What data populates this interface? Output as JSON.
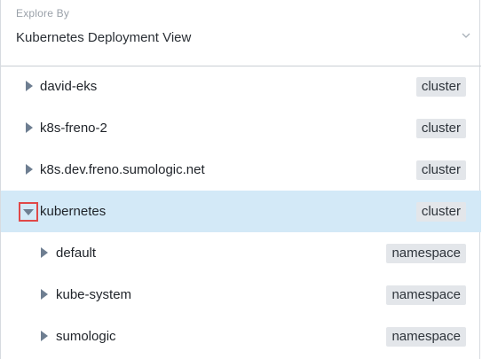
{
  "header": {
    "explore_label": "Explore By",
    "view_value": "Kubernetes Deployment View",
    "dropdown_icon": "chevron-down-icon"
  },
  "tree": {
    "rows": [
      {
        "name": "david-eks",
        "badge": "cluster",
        "level": 0,
        "expanded": false,
        "selected": false
      },
      {
        "name": "k8s-freno-2",
        "badge": "cluster",
        "level": 0,
        "expanded": false,
        "selected": false
      },
      {
        "name": "k8s.dev.freno.sumologic.net",
        "badge": "cluster",
        "level": 0,
        "expanded": false,
        "selected": false
      },
      {
        "name": "kubernetes",
        "badge": "cluster",
        "level": 0,
        "expanded": true,
        "selected": true
      },
      {
        "name": "default",
        "badge": "namespace",
        "level": 1,
        "expanded": false,
        "selected": false
      },
      {
        "name": "kube-system",
        "badge": "namespace",
        "level": 1,
        "expanded": false,
        "selected": false
      },
      {
        "name": "sumologic",
        "badge": "namespace",
        "level": 1,
        "expanded": false,
        "selected": false
      }
    ]
  },
  "colors": {
    "selected_row": "#d3e9f7",
    "badge_bg": "#e3e6ea",
    "caret": "#6e7e91",
    "highlight_box": "#e04848"
  }
}
